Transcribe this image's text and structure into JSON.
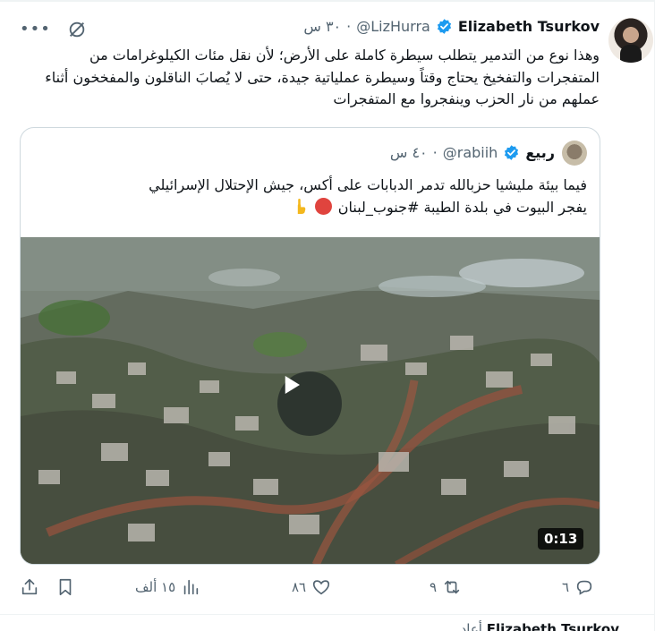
{
  "tweet": {
    "display_name": "Elizabeth Tsurkov",
    "handle": "@LizHurra",
    "time": "٣٠ س",
    "text": "وهذا نوع من التدمير يتطلب سيطرة كاملة على الأرض؛ لأن نقل مئات الكيلوغرامات من المتفجرات والتفخيخ يحتاج وقتاً وسيطرة عملياتية جيدة، حتى لا يُصابَ الناقلون والمفخخون أثناء عملهم من نار الحزب وينفجروا مع المتفجرات"
  },
  "quote": {
    "display_name": "ربيع",
    "handle": "@rabiih",
    "time": "٤٠ س",
    "text_line1": "فيما بيئة مليشيا حزبالله تدمر الدبابات على أكس، جيش الإحتلال الإسرائيلي",
    "text_line2": "يفجر البيوت في بلدة الطيبة #جنوب_لبنان",
    "video_duration": "0:13"
  },
  "actions": {
    "replies": "٦",
    "reposts": "٩",
    "likes": "٨٦",
    "views": "١٥ ألف"
  },
  "next_tweet": {
    "display_name": "Elizabeth Tsurkov",
    "handle_prefix": "أعاد"
  },
  "colors": {
    "verified": "#1d9bf0",
    "muted": "#536471",
    "text": "#0f1419",
    "border": "#cfd9de"
  },
  "icons": [
    "more-icon",
    "grok-icon",
    "verified-badge-icon",
    "play-icon",
    "reply-icon",
    "repost-icon",
    "like-icon",
    "views-icon",
    "bookmark-icon",
    "share-icon"
  ]
}
